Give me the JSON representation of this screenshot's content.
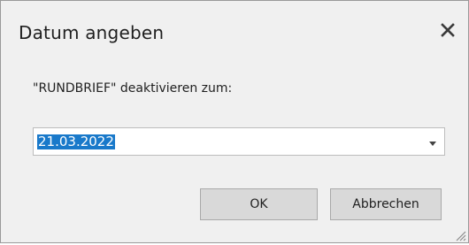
{
  "dialog": {
    "title": "Datum angeben",
    "close_icon": "close-icon",
    "prompt": "\"RUNDBRIEF\" deaktivieren zum:",
    "date_value": "21.03.2022",
    "dropdown_icon": "chevron-down-icon",
    "ok_label": "OK",
    "cancel_label": "Abbrechen",
    "resize_icon": "resize-grip-icon"
  },
  "colors": {
    "background": "#f0f0f0",
    "selection": "#1979ca",
    "button": "#d9d9d9"
  }
}
